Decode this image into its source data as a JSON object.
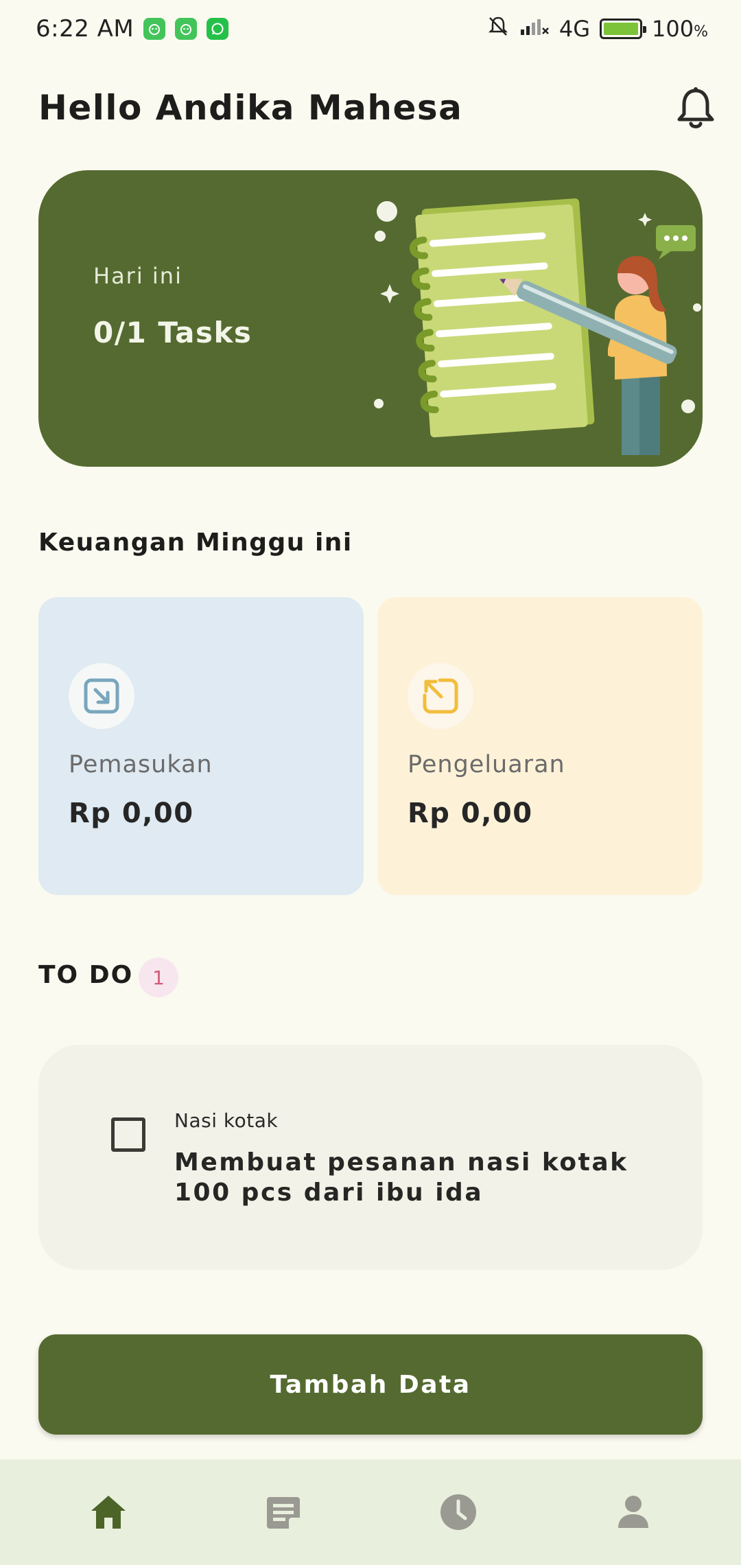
{
  "status_bar": {
    "time": "6:22 AM",
    "network": "4G",
    "battery": "100",
    "battery_unit": "%",
    "notification_icons": [
      "app-icon",
      "app-icon",
      "whatsapp-icon"
    ]
  },
  "header": {
    "greeting": "Hello Andika Mahesa"
  },
  "hero": {
    "label": "Hari ini",
    "tasks": "0/1 Tasks"
  },
  "finance": {
    "title": "Keuangan Minggu ini",
    "income": {
      "label": "Pemasukan",
      "amount": "Rp 0,00"
    },
    "expense": {
      "label": "Pengeluaran",
      "amount": "Rp 0,00"
    }
  },
  "todo": {
    "title": "TO DO",
    "count": "1",
    "items": [
      {
        "category": "Nasi kotak",
        "text": "Membuat pesanan nasi kotak 100 pcs dari  ibu ida",
        "checked": false
      }
    ]
  },
  "actions": {
    "add_label": "Tambah Data"
  },
  "nav": [
    "home-icon",
    "notes-icon",
    "history-icon",
    "profile-icon"
  ],
  "colors": {
    "primary": "#556a30",
    "background": "#fafaf0",
    "income_bg": "#dfeaf2",
    "expense_bg": "#fdf2d8",
    "badge": "#d35a79"
  }
}
